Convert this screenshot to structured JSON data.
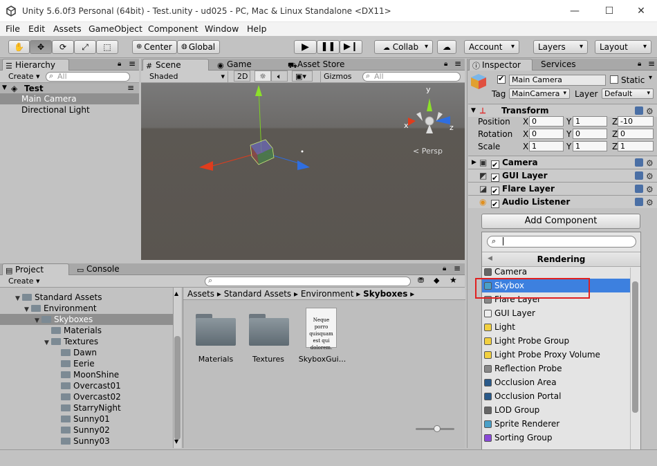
{
  "window": {
    "title": "Unity 5.6.0f3 Personal (64bit) - Test.unity - ud025 - PC, Mac & Linux Standalone <DX11>"
  },
  "menu": [
    "File",
    "Edit",
    "Assets",
    "GameObject",
    "Component",
    "Window",
    "Help"
  ],
  "toolbar": {
    "pivot": "Center",
    "space": "Global",
    "collab": "Collab",
    "account": "Account",
    "layers": "Layers",
    "layout": "Layout"
  },
  "hierarchy": {
    "tab": "Hierarchy",
    "create": "Create",
    "search_placeholder": "All",
    "scene": "Test",
    "items": [
      "Main Camera",
      "Directional Light"
    ]
  },
  "scene": {
    "tabs": [
      "Scene",
      "Game",
      "Asset Store"
    ],
    "shading": "Shaded",
    "mode_2d": "2D",
    "gizmos": "Gizmos",
    "search_placeholder": "All",
    "persp": "Persp",
    "axis_y": "y",
    "axis_x": "x",
    "axis_z": "z"
  },
  "project": {
    "tabs": [
      "Project",
      "Console"
    ],
    "create": "Create",
    "tree": [
      {
        "label": "Standard Assets",
        "depth": 1,
        "open": true
      },
      {
        "label": "Environment",
        "depth": 2,
        "open": true
      },
      {
        "label": "Skyboxes",
        "depth": 3,
        "open": true,
        "selected": true
      },
      {
        "label": "Materials",
        "depth": 4,
        "open": false
      },
      {
        "label": "Textures",
        "depth": 4,
        "open": true
      },
      {
        "label": "Dawn",
        "depth": 5
      },
      {
        "label": "Eerie",
        "depth": 5
      },
      {
        "label": "MoonShine",
        "depth": 5
      },
      {
        "label": "Overcast01",
        "depth": 5
      },
      {
        "label": "Overcast02",
        "depth": 5
      },
      {
        "label": "StarryNight",
        "depth": 5
      },
      {
        "label": "Sunny01",
        "depth": 5
      },
      {
        "label": "Sunny02",
        "depth": 5
      },
      {
        "label": "Sunny03",
        "depth": 5
      }
    ],
    "breadcrumb": [
      "Assets",
      "Standard Assets",
      "Environment",
      "Skyboxes"
    ],
    "assets": [
      "Materials",
      "Textures",
      "SkyboxGui..."
    ],
    "doc_text": "Neque porro quisquam est qui dolorem."
  },
  "inspector": {
    "tabs": [
      "Inspector",
      "Services"
    ],
    "object_name": "Main Camera",
    "static_label": "Static",
    "tag_label": "Tag",
    "tag_value": "MainCamera",
    "layer_label": "Layer",
    "layer_value": "Default",
    "transform": {
      "title": "Transform",
      "position_label": "Position",
      "rotation_label": "Rotation",
      "scale_label": "Scale",
      "axis_x": "X",
      "axis_y": "Y",
      "axis_z": "Z",
      "position": [
        "0",
        "1",
        "-10"
      ],
      "rotation": [
        "0",
        "0",
        "0"
      ],
      "scale": [
        "1",
        "1",
        "1"
      ]
    },
    "components": [
      "Camera",
      "GUI Layer",
      "Flare Layer",
      "Audio Listener"
    ],
    "add_component": "Add Component"
  },
  "popup": {
    "header": "Rendering",
    "items": [
      "Camera",
      "Skybox",
      "Flare Layer",
      "GUI Layer",
      "Light",
      "Light Probe Group",
      "Light Probe Proxy Volume",
      "Reflection Probe",
      "Occlusion Area",
      "Occlusion Portal",
      "LOD Group",
      "Sprite Renderer",
      "Sorting Group"
    ],
    "selected": "Skybox"
  },
  "colors": {
    "selection": "#3d80df",
    "highlight_box": "#e02020",
    "scene_sky": "#757575",
    "scene_ground": "#5c5752"
  }
}
